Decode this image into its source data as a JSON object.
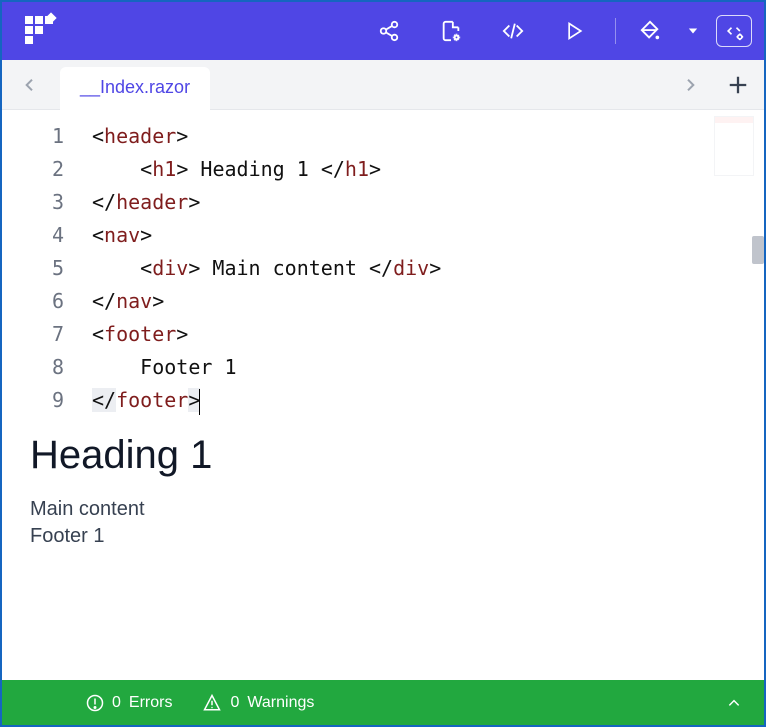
{
  "tab": {
    "filename": "__Index.razor"
  },
  "editor": {
    "lines": [
      {
        "n": "1",
        "tokens": [
          {
            "t": "punc",
            "v": "<"
          },
          {
            "t": "tagn",
            "v": "header"
          },
          {
            "t": "punc",
            "v": ">"
          }
        ],
        "indent": 0
      },
      {
        "n": "2",
        "tokens": [
          {
            "t": "punc",
            "v": "<"
          },
          {
            "t": "tagn",
            "v": "h1"
          },
          {
            "t": "punc",
            "v": ">"
          },
          {
            "t": "txt",
            "v": " Heading 1 "
          },
          {
            "t": "punc",
            "v": "</"
          },
          {
            "t": "tagn",
            "v": "h1"
          },
          {
            "t": "punc",
            "v": ">"
          }
        ],
        "indent": 1
      },
      {
        "n": "3",
        "tokens": [
          {
            "t": "punc",
            "v": "</"
          },
          {
            "t": "tagn",
            "v": "header"
          },
          {
            "t": "punc",
            "v": ">"
          }
        ],
        "indent": 0
      },
      {
        "n": "4",
        "tokens": [
          {
            "t": "punc",
            "v": "<"
          },
          {
            "t": "tagn",
            "v": "nav"
          },
          {
            "t": "punc",
            "v": ">"
          }
        ],
        "indent": 0
      },
      {
        "n": "5",
        "tokens": [
          {
            "t": "punc",
            "v": "<"
          },
          {
            "t": "tagn",
            "v": "div"
          },
          {
            "t": "punc",
            "v": ">"
          },
          {
            "t": "txt",
            "v": " Main content "
          },
          {
            "t": "punc",
            "v": "</"
          },
          {
            "t": "tagn",
            "v": "div"
          },
          {
            "t": "punc",
            "v": ">"
          }
        ],
        "indent": 1
      },
      {
        "n": "6",
        "tokens": [
          {
            "t": "punc",
            "v": "</"
          },
          {
            "t": "tagn",
            "v": "nav"
          },
          {
            "t": "punc",
            "v": ">"
          }
        ],
        "indent": 0
      },
      {
        "n": "7",
        "tokens": [
          {
            "t": "punc",
            "v": "<"
          },
          {
            "t": "tagn",
            "v": "footer"
          },
          {
            "t": "punc",
            "v": ">"
          }
        ],
        "indent": 0
      },
      {
        "n": "8",
        "tokens": [
          {
            "t": "txt",
            "v": "Footer 1"
          }
        ],
        "indent": 1
      },
      {
        "n": "9",
        "tokens": [
          {
            "t": "punc",
            "v": "</"
          },
          {
            "t": "tagn",
            "v": "footer"
          },
          {
            "t": "punc",
            "v": ">"
          }
        ],
        "indent": 0,
        "cursor": true,
        "selwrap": true
      }
    ]
  },
  "preview": {
    "heading": "Heading 1",
    "main": "Main content",
    "footer": "Footer 1"
  },
  "status": {
    "errors_count": "0",
    "errors_label": "Errors",
    "warnings_count": "0",
    "warnings_label": "Warnings"
  }
}
